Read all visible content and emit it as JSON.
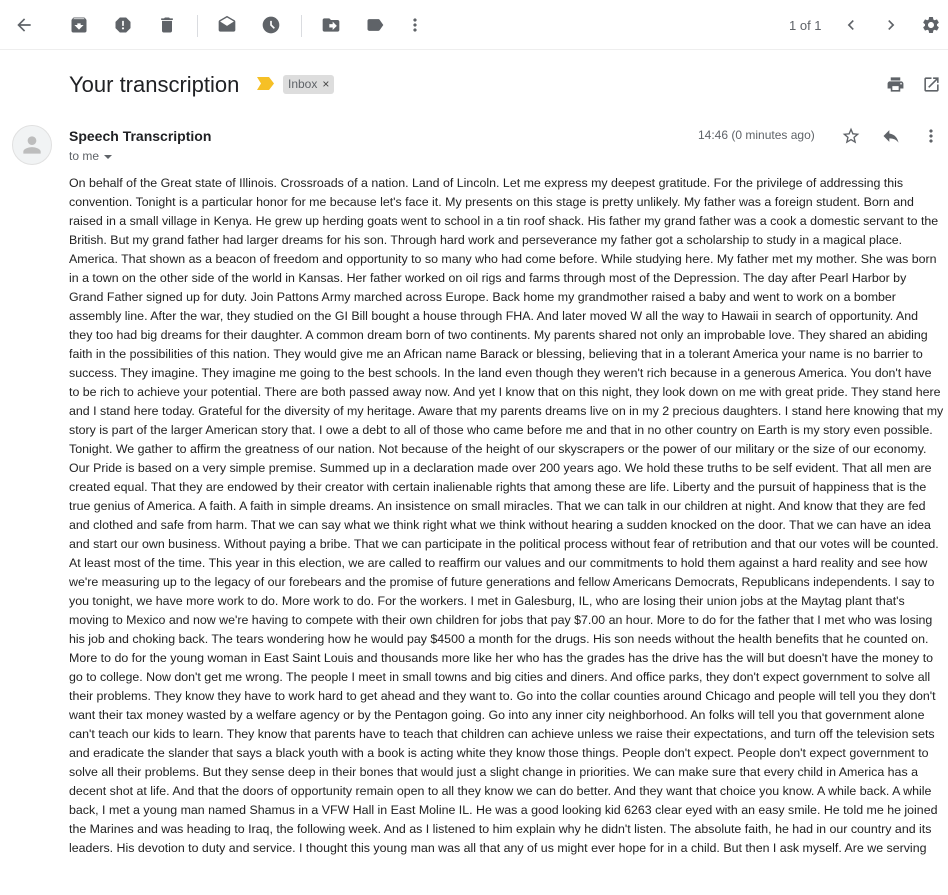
{
  "toolbar": {
    "icons": [
      "back-arrow-icon",
      "archive-icon",
      "report-spam-icon",
      "delete-icon",
      "mark-unread-icon",
      "snooze-icon",
      "move-to-icon",
      "labels-icon",
      "more-vert-icon",
      "chevron-left-icon",
      "chevron-right-icon",
      "settings-gear-icon"
    ],
    "pager_text": "1 of 1"
  },
  "email": {
    "subject": "Your transcription",
    "label": "Inbox",
    "label_remove": "×",
    "sender": "Speech Transcription",
    "recipient": "to me",
    "time": "14:46 (0 minutes ago)",
    "body": "On behalf of the Great state of Illinois. Crossroads of a nation. Land of Lincoln. Let me express my deepest gratitude. For the privilege of addressing this convention. Tonight is a particular honor for me because let's face it. My presents on this stage is pretty unlikely. My father was a foreign student. Born and raised in a small village in Kenya. He grew up herding goats went to school in a tin roof shack. His father my grand father was a cook a domestic servant to the British. But my grand father had larger dreams for his son. Through hard work and perseverance my father got a scholarship to study in a magical place. America. That shown as a beacon of freedom and opportunity to so many who had come before. While studying here. My father met my mother. She was born in a town on the other side of the world in Kansas. Her father worked on oil rigs and farms through most of the Depression. The day after Pearl Harbor by Grand Father signed up for duty. Join Pattons Army marched across Europe. Back home my grandmother raised a baby and went to work on a bomber assembly line. After the war, they studied on the GI Bill bought a house through FHA. And later moved W all the way to Hawaii in search of opportunity. And they too had big dreams for their daughter. A common dream born of two continents. My parents shared not only an improbable love. They shared an abiding faith in the possibilities of this nation. They would give me an African name Barack or blessing, believing that in a tolerant America your name is no barrier to success. They imagine. They imagine me going to the best schools. In the land even though they weren't rich because in a generous America. You don't have to be rich to achieve your potential. There are both passed away now. And yet I know that on this night, they look down on me with great pride. They stand here and I stand here today. Grateful for the diversity of my heritage. Aware that my parents dreams live on in my 2 precious daughters. I stand here knowing that my story is part of the larger American story that. I owe a debt to all of those who came before me and that in no other country on Earth is my story even possible. Tonight. We gather to affirm the greatness of our nation. Not because of the height of our skyscrapers or the power of our military or the size of our economy. Our Pride is based on a very simple premise. Summed up in a declaration made over 200 years ago. We hold these truths to be self evident. That all men are created equal. That they are endowed by their creator with certain inalienable rights that among these are life. Liberty and the pursuit of happiness that is the true genius of America. A faith. A faith in simple dreams. An insistence on small miracles. That we can talk in our children at night. And know that they are fed and clothed and safe from harm. That we can say what we think right what we think without hearing a sudden knocked on the door. That we can have an idea and start our own business. Without paying a bribe. That we can participate in the political process without fear of retribution and that our votes will be counted. At least most of the time. This year in this election, we are called to reaffirm our values and our commitments to hold them against a hard reality and see how we're measuring up to the legacy of our forebears and the promise of future generations and fellow Americans Democrats, Republicans independents. I say to you tonight, we have more work to do. More work to do. For the workers. I met in Galesburg, IL, who are losing their union jobs at the Maytag plant that's moving to Mexico and now we're having to compete with their own children for jobs that pay $7.00 an hour. More to do for the father that I met who was losing his job and choking back. The tears wondering how he would pay $4500 a month for the drugs. His son needs without the health benefits that he counted on. More to do for the young woman in East Saint Louis and thousands more like her who has the grades has the drive has the will but doesn't have the money to go to college. Now don't get me wrong. The people I meet in small towns and big cities and diners. And office parks, they don't expect government to solve all their problems. They know they have to work hard to get ahead and they want to. Go into the collar counties around Chicago and people will tell you they don't want their tax money wasted by a welfare agency or by the Pentagon going. Go into any inner city neighborhood. An folks will tell you that government alone can't teach our kids to learn. They know that parents have to teach that children can achieve unless we raise their expectations, and turn off the television sets and eradicate the slander that says a black youth with a book is acting white they know those things. People don't expect. People don't expect government to solve all their problems. But they sense deep in their bones that would just a slight change in priorities. We can make sure that every child in America has a decent shot at life. And that the doors of opportunity remain open to all they know we can do better. And they want that choice you know. A while back. A while back, I met a young man named Shamus in a VFW Hall in East Moline IL. He was a good looking kid 6263 clear eyed with an easy smile. He told me he joined the Marines and was heading to Iraq, the following week. And as I listened to him explain why he didn't listen. The absolute faith, he had in our country and its leaders. His devotion to duty and service. I thought this young man was all that any of us might ever hope for in a child. But then I ask myself. Are we serving"
  },
  "colors": {
    "icon_gray": "#5f6368",
    "importance_marker": "#f6c026",
    "label_bg": "#dddddd"
  }
}
